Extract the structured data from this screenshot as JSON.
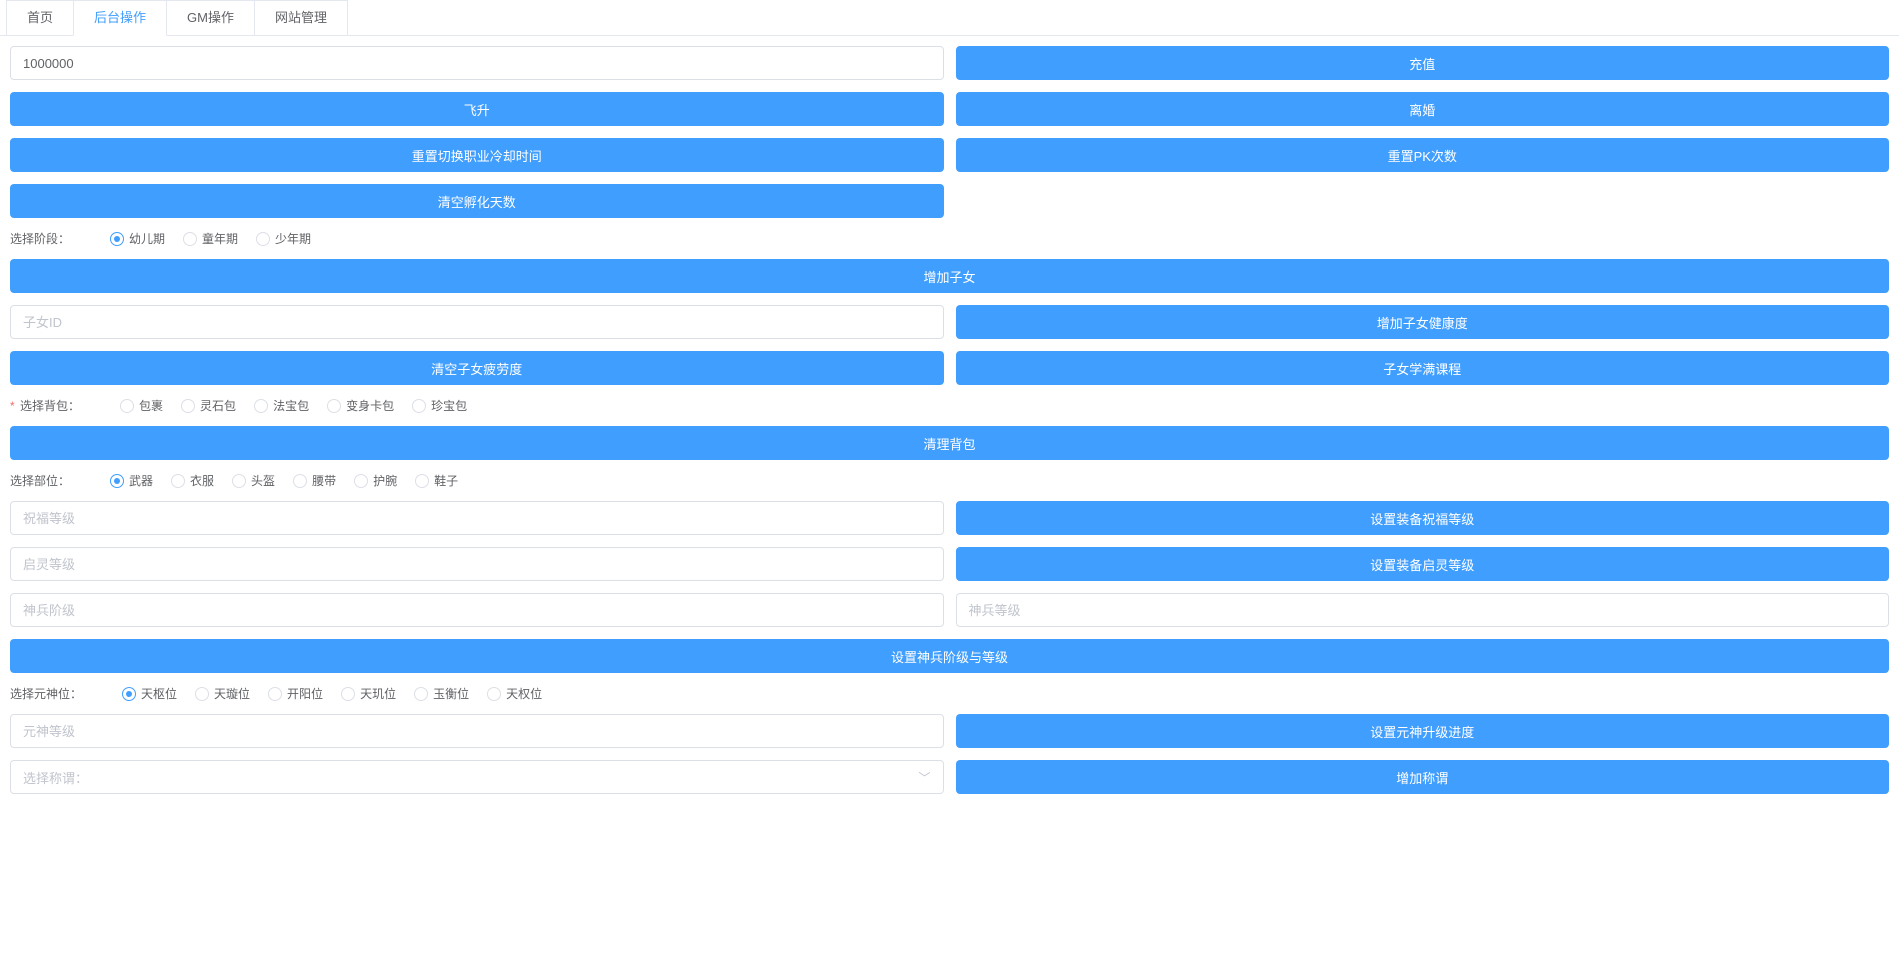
{
  "tabs": [
    {
      "label": "首页",
      "active": false
    },
    {
      "label": "后台操作",
      "active": true
    },
    {
      "label": "GM操作",
      "active": false
    },
    {
      "label": "网站管理",
      "active": false
    }
  ],
  "recharge": {
    "value": "1000000",
    "button": "充值"
  },
  "row2": {
    "left": "飞升",
    "right": "离婚"
  },
  "row3": {
    "left": "重置切换职业冷却时间",
    "right": "重置PK次数"
  },
  "row4": {
    "left": "清空孵化天数"
  },
  "stage": {
    "label": "选择阶段：",
    "options": [
      "幼儿期",
      "童年期",
      "少年期"
    ],
    "selected": 0
  },
  "addChild": "增加子女",
  "childId": {
    "placeholder": "子女ID",
    "button": "增加子女健康度"
  },
  "row7": {
    "left": "清空子女疲劳度",
    "right": "子女学满课程"
  },
  "bag": {
    "label": "选择背包：",
    "options": [
      "包裹",
      "灵石包",
      "法宝包",
      "变身卡包",
      "珍宝包"
    ],
    "selected": -1
  },
  "clearBag": "清理背包",
  "part": {
    "label": "选择部位：",
    "options": [
      "武器",
      "衣服",
      "头盔",
      "腰带",
      "护腕",
      "鞋子"
    ],
    "selected": 0
  },
  "bless": {
    "placeholder": "祝福等级",
    "button": "设置装备祝福等级"
  },
  "qiling": {
    "placeholder": "启灵等级",
    "button": "设置装备启灵等级"
  },
  "shenbing": {
    "placeholder1": "神兵阶级",
    "placeholder2": "神兵等级"
  },
  "setShenbing": "设置神兵阶级与等级",
  "yuanshen": {
    "label": "选择元神位：",
    "options": [
      "天枢位",
      "天璇位",
      "开阳位",
      "天玑位",
      "玉衡位",
      "天权位"
    ],
    "selected": 0
  },
  "yuanshenLevel": {
    "placeholder": "元神等级",
    "button": "设置元神升级进度"
  },
  "title": {
    "placeholder": "选择称谓：",
    "button": "增加称谓"
  }
}
